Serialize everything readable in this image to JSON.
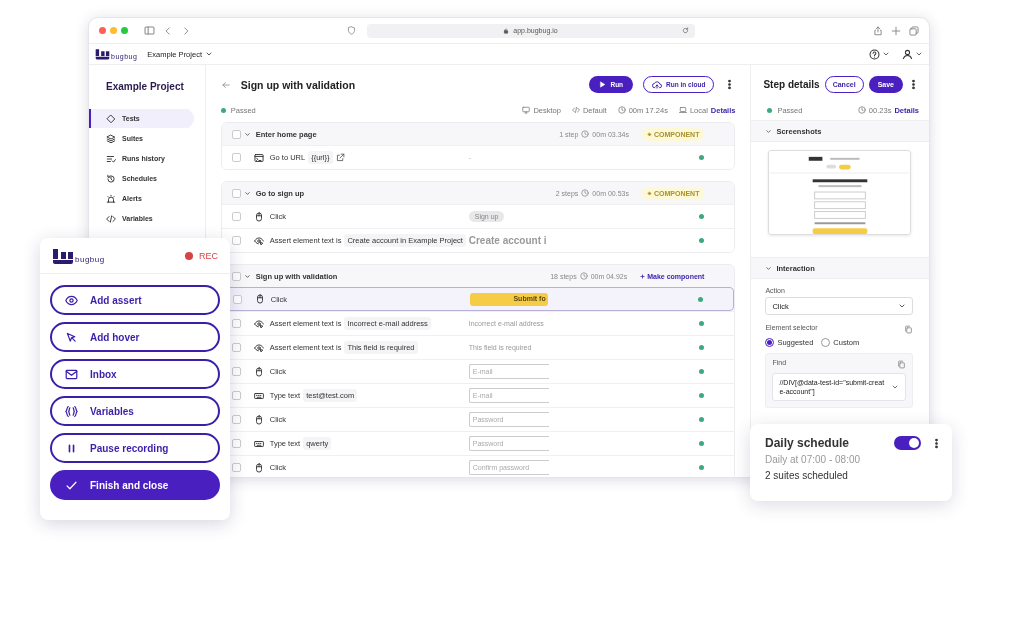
{
  "browser": {
    "url": "app.bugbug.io"
  },
  "header": {
    "logo_text": "bugbug",
    "project": "Example Project"
  },
  "sidebar": {
    "title": "Example Project",
    "items": [
      {
        "label": "Tests",
        "selected": true
      },
      {
        "label": "Suites",
        "selected": false
      },
      {
        "label": "Runs history",
        "selected": false
      },
      {
        "label": "Schedules",
        "selected": false
      },
      {
        "label": "Alerts",
        "selected": false
      },
      {
        "label": "Variables",
        "selected": false
      }
    ]
  },
  "test": {
    "title": "Sign up with validation",
    "run": "Run",
    "run_cloud": "Run in cloud",
    "status": "Passed",
    "device": "Desktop",
    "profile": "Default",
    "duration": "00m 17.24s",
    "location": "Local",
    "details": "Details",
    "groups": [
      {
        "name": "Enter home page",
        "checked": false,
        "steps_count": "1 step",
        "duration": "00m 03.34s",
        "badge": {
          "kind": "component",
          "label": "COMPONENT"
        },
        "steps": [
          {
            "kind": "url",
            "checked": false,
            "action": "Go to URL",
            "value": "{{url}}",
            "link": true,
            "preview": {
              "kind": "dash",
              "text": "-"
            },
            "selected": false,
            "passed": true
          }
        ]
      },
      {
        "name": "Go to sign up",
        "checked": false,
        "steps_count": "2 steps",
        "duration": "00m 00.53s",
        "badge": {
          "kind": "component",
          "label": "COMPONENT"
        },
        "steps": [
          {
            "kind": "click",
            "checked": false,
            "action": "Click",
            "link": false,
            "preview": {
              "kind": "button",
              "text": "Sign up"
            },
            "selected": false,
            "passed": true
          },
          {
            "kind": "assert",
            "checked": false,
            "action": "Assert element text is",
            "value": "Create account in Example Project",
            "link": false,
            "preview": {
              "kind": "heading",
              "text": "Create account i"
            },
            "selected": false,
            "passed": true
          }
        ]
      },
      {
        "name": "Sign up with validation",
        "checked": false,
        "steps_count": "18 steps",
        "duration": "00m 04.92s",
        "badge": {
          "kind": "make",
          "label": "Make component"
        },
        "steps": [
          {
            "kind": "click",
            "checked": false,
            "action": "Click",
            "link": false,
            "preview": {
              "kind": "primary",
              "text": "Submit fo"
            },
            "selected": true,
            "passed": true
          },
          {
            "kind": "assert",
            "checked": false,
            "action": "Assert element text is",
            "value": "Incorrect e-mail address",
            "link": false,
            "preview": {
              "kind": "text",
              "text": "Incorrect e-mail address"
            },
            "selected": false,
            "passed": true
          },
          {
            "kind": "assert",
            "checked": false,
            "action": "Assert element text is",
            "value": "This field is required",
            "link": false,
            "preview": {
              "kind": "text",
              "text": "This field is required"
            },
            "selected": false,
            "passed": true
          },
          {
            "kind": "click",
            "checked": false,
            "action": "Click",
            "link": false,
            "preview": {
              "kind": "input",
              "text": "E-mail"
            },
            "selected": false,
            "passed": true
          },
          {
            "kind": "type",
            "checked": false,
            "action": "Type text",
            "value": "test@test.com",
            "link": false,
            "preview": {
              "kind": "input",
              "text": "E-mail"
            },
            "selected": false,
            "passed": true
          },
          {
            "kind": "click",
            "checked": false,
            "action": "Click",
            "link": false,
            "preview": {
              "kind": "input",
              "text": "Password"
            },
            "selected": false,
            "passed": true
          },
          {
            "kind": "type",
            "checked": false,
            "action": "Type text",
            "value": "qwerty",
            "link": false,
            "preview": {
              "kind": "input",
              "text": "Password"
            },
            "selected": false,
            "passed": true
          },
          {
            "kind": "click",
            "checked": false,
            "action": "Click",
            "link": false,
            "preview": {
              "kind": "input",
              "text": "Confirm password"
            },
            "selected": false,
            "passed": true
          }
        ]
      }
    ]
  },
  "step_details": {
    "title": "Step details",
    "cancel": "Cancel",
    "save": "Save",
    "status": "Passed",
    "duration": "00.23s",
    "details": "Details",
    "screenshots": {
      "title": "Screenshots"
    },
    "interaction": {
      "title": "Interaction",
      "action_label": "Action",
      "action": "Click",
      "selector_label": "Element selector",
      "selector_options": [
        {
          "label": "Suggested",
          "selected": true
        },
        {
          "label": "Custom",
          "selected": false
        }
      ],
      "find_label": "Find",
      "find_value": "//DIV[@data-test-id=\"submit-create-account\"]"
    }
  },
  "recorder": {
    "logo_text": "bugbug",
    "rec": "REC",
    "actions": [
      {
        "label": "Add assert",
        "kind": "outline"
      },
      {
        "label": "Add hover",
        "kind": "outline"
      },
      {
        "label": "Inbox",
        "kind": "outline"
      },
      {
        "label": "Variables",
        "kind": "outline"
      },
      {
        "label": "Pause recording",
        "kind": "outline"
      },
      {
        "label": "Finish and close",
        "kind": "primary"
      }
    ]
  },
  "schedule": {
    "title": "Daily schedule",
    "enabled": true,
    "time": "Daily at 07:00 - 08:00",
    "summary": "2 suites scheduled"
  }
}
